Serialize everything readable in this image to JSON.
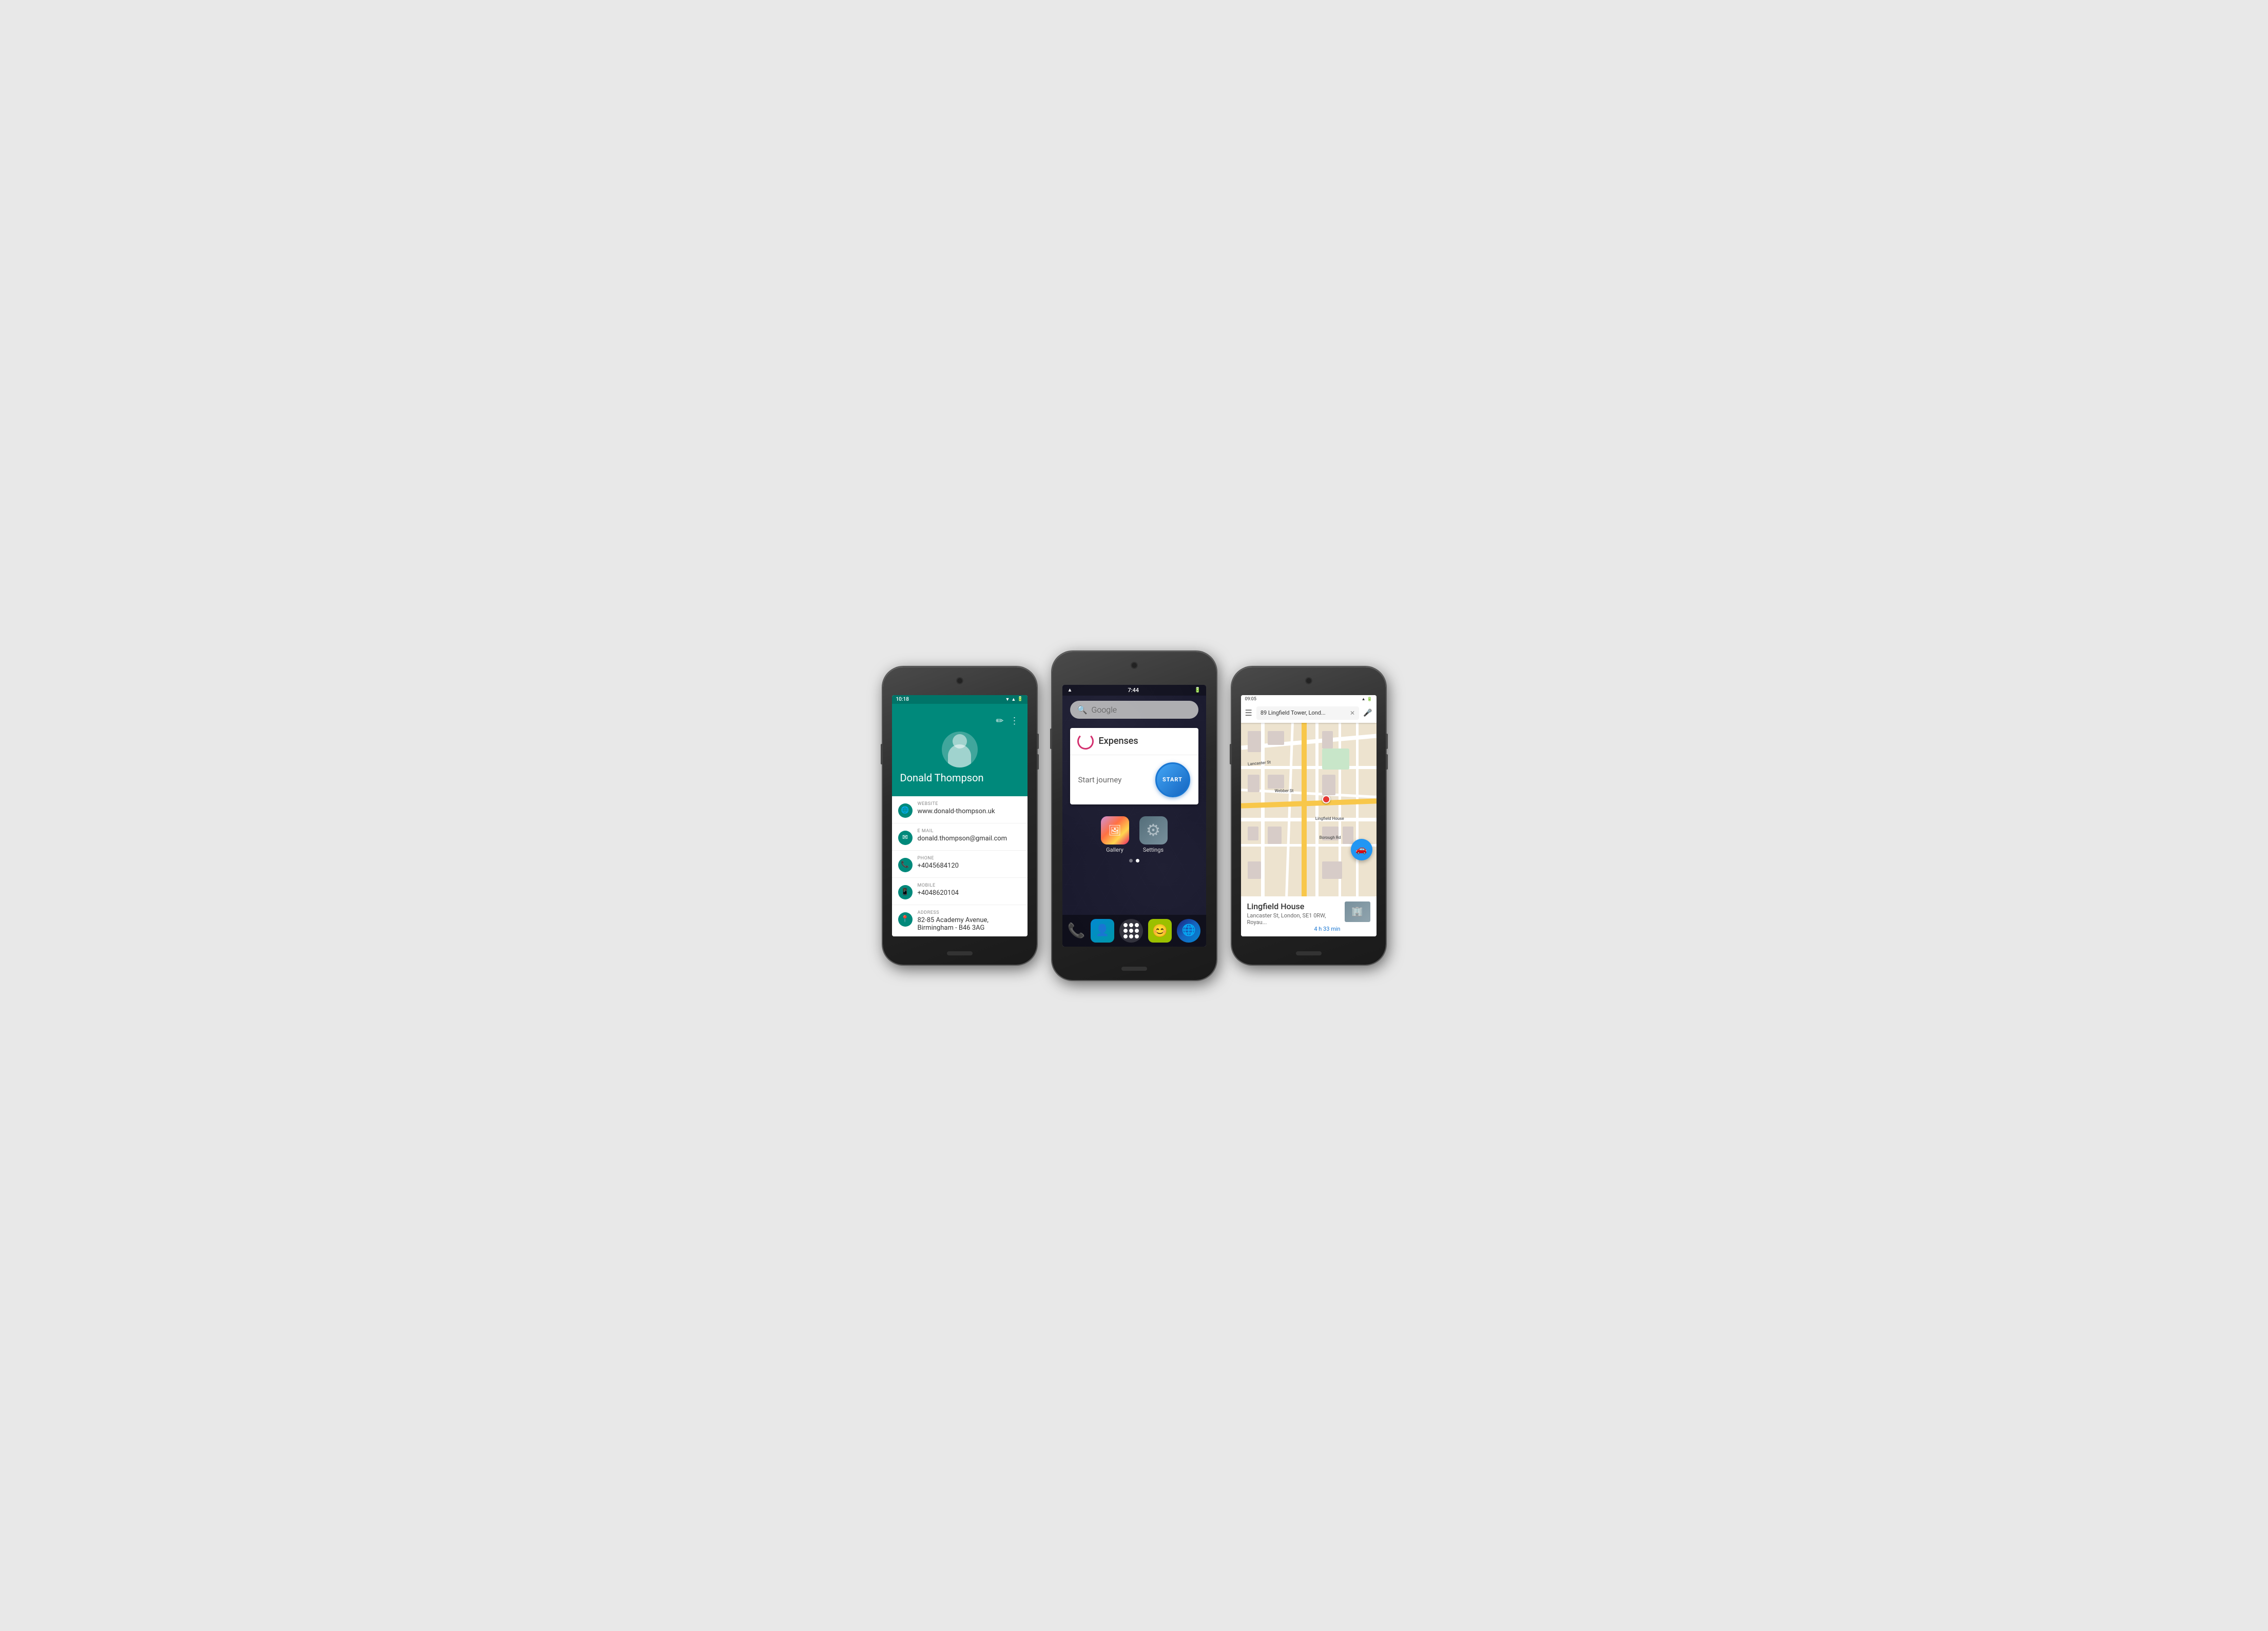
{
  "phone1": {
    "statusBar": {
      "time": "10:18",
      "icons": [
        "▼",
        "✦",
        "🔋"
      ]
    },
    "headerActions": [
      "✏",
      "⋮"
    ],
    "contactName": "Donald Thompson",
    "fields": [
      {
        "icon": "🌐",
        "label": "WEBSITE",
        "value": "www.donald-thompson.uk"
      },
      {
        "icon": "✉",
        "label": "E MAIL",
        "value": "donald.thompson@gmail.com"
      },
      {
        "icon": "📞",
        "label": "PHONE",
        "value": "+4045684120"
      },
      {
        "icon": "📱",
        "label": "MOBILE",
        "value": "+4048620104"
      },
      {
        "icon": "📍",
        "label": "ADDRESS",
        "value": "82-85 Academy Avenue, Birmingham - B46 3AG"
      }
    ]
  },
  "phone2": {
    "statusBar": {
      "time": "7:44",
      "icons": [
        "▲",
        "🔋"
      ]
    },
    "searchBar": {
      "placeholder": "Google"
    },
    "widget": {
      "title": "Expenses",
      "label": "Start journey",
      "buttonText": "START"
    },
    "appGrid": [
      {
        "name": "Gallery",
        "icon": "gallery"
      },
      {
        "name": "Settings",
        "icon": "settings"
      }
    ],
    "dock": [
      {
        "name": "phone",
        "icon": "phone"
      },
      {
        "name": "contacts",
        "icon": "contacts"
      },
      {
        "name": "apps",
        "icon": "apps"
      },
      {
        "name": "messenger",
        "icon": "messenger"
      },
      {
        "name": "globe",
        "icon": "globe"
      }
    ],
    "pageDots": [
      false,
      true
    ]
  },
  "phone3": {
    "statusBar": {
      "time": "09:05",
      "icons": [
        "📶",
        "🔋"
      ]
    },
    "searchBar": {
      "value": "89 Lingfield Tower, Lond...",
      "hasClose": true,
      "hasMic": true
    },
    "mapPin": {
      "label": "Lingfield House"
    },
    "bottomCard": {
      "placeName": "Lingfield House",
      "address": "Lancaster St, London, SE1 0RW, Royau...",
      "duration": "4 h 33 min"
    }
  }
}
